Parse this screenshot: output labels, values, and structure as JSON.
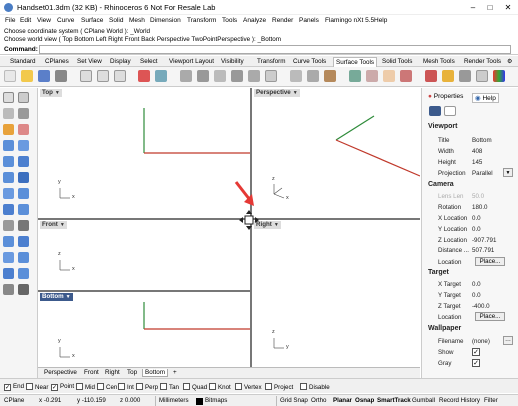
{
  "window": {
    "title": "Handset01.3dm (32 KB) - Rhinoceros 6 Not For Resale Lab",
    "minimize": "–",
    "maximize": "□",
    "close": "✕"
  },
  "menu": [
    "File",
    "Edit",
    "View",
    "Curve",
    "Surface",
    "Solid",
    "Mesh",
    "Dimension",
    "Transform",
    "Tools",
    "Analyze",
    "Render",
    "Panels",
    "Flamingo nXt 5.5",
    "Help"
  ],
  "command": {
    "history": [
      "Choose coordinate system ( CPlane  World ): _World",
      "Choose world view ( Top  Bottom  Left  Right  Front  Back  Perspective  TwoPointPerspective ): _Bottom"
    ],
    "prompt": "Command:",
    "value": ""
  },
  "toolbar_tabs": [
    "Standard",
    "CPlanes",
    "Set View",
    "Display",
    "Select",
    "Viewport Layout",
    "Visibility",
    "Transform",
    "Curve Tools",
    "Surface Tools",
    "Solid Tools",
    "Mesh Tools",
    "Render Tools"
  ],
  "toolbar_active": "Surface Tools",
  "viewports": {
    "top": {
      "label": "Top"
    },
    "perspective": {
      "label": "Perspective"
    },
    "front": {
      "label": "Front"
    },
    "right": {
      "label": "Right"
    },
    "bottom": {
      "label": "Bottom"
    },
    "axis_x": "x",
    "axis_y": "y",
    "axis_z": "z"
  },
  "viewport_tabs": [
    "Perspective",
    "Front",
    "Right",
    "Top",
    "Bottom"
  ],
  "viewport_tab_active": "Bottom",
  "viewport_tab_add": "+",
  "panel": {
    "tabs": [
      "Properties",
      "Help"
    ],
    "viewport": {
      "heading": "Viewport",
      "rows": [
        {
          "label": "Title",
          "value": "Bottom"
        },
        {
          "label": "Width",
          "value": "408"
        },
        {
          "label": "Height",
          "value": "145"
        },
        {
          "label": "Projection",
          "value": "Parallel"
        }
      ]
    },
    "camera": {
      "heading": "Camera",
      "rows": [
        {
          "label": "Lens Len",
          "value": "50.0"
        },
        {
          "label": "Rotation",
          "value": "180.0"
        },
        {
          "label": "X Location",
          "value": "0.0"
        },
        {
          "label": "Y Location",
          "value": "0.0"
        },
        {
          "label": "Z Location",
          "value": "-907.791"
        },
        {
          "label": "Distance ...",
          "value": "507.791"
        },
        {
          "label": "Location",
          "value": "Place..."
        }
      ]
    },
    "target": {
      "heading": "Target",
      "rows": [
        {
          "label": "X Target",
          "value": "0.0"
        },
        {
          "label": "Y Target",
          "value": "0.0"
        },
        {
          "label": "Z Target",
          "value": "-400.0"
        },
        {
          "label": "Location",
          "value": "Place..."
        }
      ]
    },
    "wallpaper": {
      "heading": "Wallpaper",
      "rows": [
        {
          "label": "Filename",
          "value": "(none)"
        },
        {
          "label": "Show",
          "value": "✓"
        },
        {
          "label": "Gray",
          "value": "✓"
        }
      ]
    }
  },
  "osnaps": [
    {
      "label": "End",
      "checked": true
    },
    {
      "label": "Near",
      "checked": false
    },
    {
      "label": "Point",
      "checked": true
    },
    {
      "label": "Mid",
      "checked": false
    },
    {
      "label": "Cen",
      "checked": false
    },
    {
      "label": "Int",
      "checked": false
    },
    {
      "label": "Perp",
      "checked": false
    },
    {
      "label": "Tan",
      "checked": false
    },
    {
      "label": "Quad",
      "checked": false
    },
    {
      "label": "Knot",
      "checked": false
    },
    {
      "label": "Vertex",
      "checked": false
    },
    {
      "label": "Project",
      "checked": false
    },
    {
      "label": "Disable",
      "checked": false
    }
  ],
  "status": {
    "cplane": "CPlane",
    "x": "x -0.291",
    "y": "y -110.159",
    "z": "z 0.000",
    "units": "Millimeters",
    "layer": "Bitmaps",
    "grid_snap": "Grid Snap",
    "ortho": "Ortho",
    "planar": "Planar",
    "osnap": "Osnap",
    "smarttrack": "SmartTrack",
    "gumball": "Gumball",
    "record_history": "Record History",
    "filter": "Filter"
  },
  "colors": {
    "x_axis": "#c0392b",
    "y_axis": "#2e8b3a",
    "active_viewport": "#3c5a8c",
    "pointer_arrow": "#e53935"
  }
}
